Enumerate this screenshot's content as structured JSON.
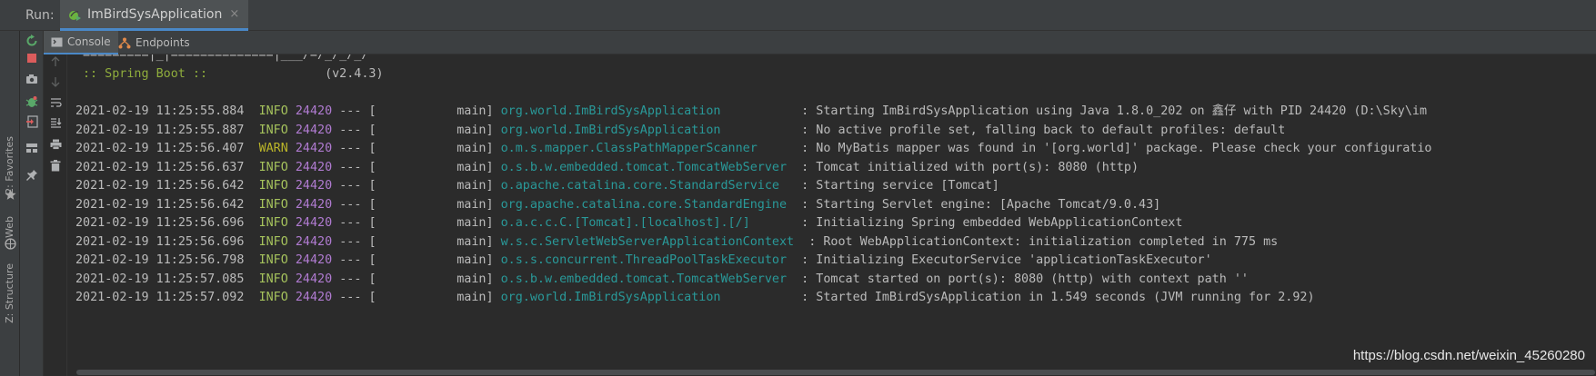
{
  "runbar": {
    "label": "Run:",
    "tab_title": "ImBirdSysApplication",
    "tab_close": "×"
  },
  "subtabs": {
    "console": "Console",
    "endpoints": "Endpoints"
  },
  "left_strip": {
    "favorites": "2: Favorites",
    "web": "Web",
    "structure": "Z: Structure"
  },
  "console": {
    "banner_line": "=========|_|==============|___/=/_/_/_/",
    "spring_label": ":: Spring Boot ::",
    "spring_version": "(v2.4.3)",
    "logs": [
      {
        "ts": "2021-02-19 11:25:55.884",
        "level": "INFO",
        "pid": "24420",
        "thread": "--- [           main]",
        "logger": "org.world.ImBirdSysApplication          ",
        "msg": ": Starting ImBirdSysApplication using Java 1.8.0_202 on 鑫仔 with PID 24420 (D:\\Sky\\im"
      },
      {
        "ts": "2021-02-19 11:25:55.887",
        "level": "INFO",
        "pid": "24420",
        "thread": "--- [           main]",
        "logger": "org.world.ImBirdSysApplication          ",
        "msg": ": No active profile set, falling back to default profiles: default"
      },
      {
        "ts": "2021-02-19 11:25:56.407",
        "level": "WARN",
        "pid": "24420",
        "thread": "--- [           main]",
        "logger": "o.m.s.mapper.ClassPathMapperScanner     ",
        "msg": ": No MyBatis mapper was found in '[org.world]' package. Please check your configuratio"
      },
      {
        "ts": "2021-02-19 11:25:56.637",
        "level": "INFO",
        "pid": "24420",
        "thread": "--- [           main]",
        "logger": "o.s.b.w.embedded.tomcat.TomcatWebServer ",
        "msg": ": Tomcat initialized with port(s): 8080 (http)"
      },
      {
        "ts": "2021-02-19 11:25:56.642",
        "level": "INFO",
        "pid": "24420",
        "thread": "--- [           main]",
        "logger": "o.apache.catalina.core.StandardService  ",
        "msg": ": Starting service [Tomcat]"
      },
      {
        "ts": "2021-02-19 11:25:56.642",
        "level": "INFO",
        "pid": "24420",
        "thread": "--- [           main]",
        "logger": "org.apache.catalina.core.StandardEngine ",
        "msg": ": Starting Servlet engine: [Apache Tomcat/9.0.43]"
      },
      {
        "ts": "2021-02-19 11:25:56.696",
        "level": "INFO",
        "pid": "24420",
        "thread": "--- [           main]",
        "logger": "o.a.c.c.C.[Tomcat].[localhost].[/]      ",
        "msg": ": Initializing Spring embedded WebApplicationContext"
      },
      {
        "ts": "2021-02-19 11:25:56.696",
        "level": "INFO",
        "pid": "24420",
        "thread": "--- [           main]",
        "logger": "w.s.c.ServletWebServerApplicationContext",
        "msg": " : Root WebApplicationContext: initialization completed in 775 ms"
      },
      {
        "ts": "2021-02-19 11:25:56.798",
        "level": "INFO",
        "pid": "24420",
        "thread": "--- [           main]",
        "logger": "o.s.s.concurrent.ThreadPoolTaskExecutor ",
        "msg": ": Initializing ExecutorService 'applicationTaskExecutor'"
      },
      {
        "ts": "2021-02-19 11:25:57.085",
        "level": "INFO",
        "pid": "24420",
        "thread": "--- [           main]",
        "logger": "o.s.b.w.embedded.tomcat.TomcatWebServer ",
        "msg": ": Tomcat started on port(s): 8080 (http) with context path ''"
      },
      {
        "ts": "2021-02-19 11:25:57.092",
        "level": "INFO",
        "pid": "24420",
        "thread": "--- [           main]",
        "logger": "org.world.ImBirdSysApplication          ",
        "msg": ": Started ImBirdSysApplication in 1.549 seconds (JVM running for 2.92)"
      }
    ]
  },
  "watermark": "https://blog.csdn.net/weixin_45260280",
  "colors": {
    "info": "#a5c25c",
    "warn": "#bbb529",
    "pid": "#b07bd1",
    "logger": "#299999",
    "accent": "#4a88c7"
  },
  "icons": {
    "run_tab": "spring-leaf-icon",
    "rerun": "rerun-icon",
    "stop": "stop-icon",
    "camera": "camera-icon",
    "debug": "debug-icon",
    "restore": "restore-icon",
    "layout": "layout-icon",
    "pin": "pin-icon",
    "up": "arrow-up-icon",
    "down": "arrow-down-icon",
    "wrap": "soft-wrap-icon",
    "scroll_end": "scroll-to-end-icon",
    "print": "print-icon",
    "trash": "trash-icon"
  }
}
